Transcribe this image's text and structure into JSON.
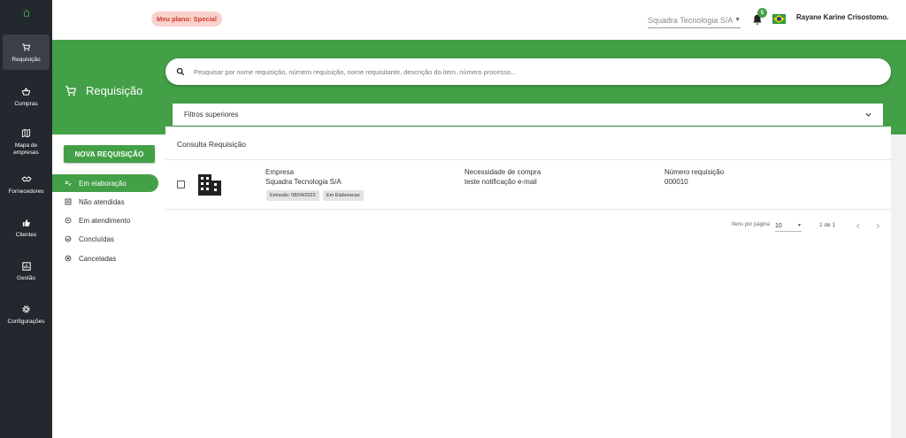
{
  "nav": {
    "items": [
      {
        "label": "Requisição"
      },
      {
        "label": "Compras"
      },
      {
        "label": "Mapa de empresas"
      },
      {
        "label": "Fornecedores"
      },
      {
        "label": "Clientes"
      },
      {
        "label": "Gestão"
      },
      {
        "label": "Configurações"
      }
    ]
  },
  "header": {
    "plan_badge": "Meu plano: Special",
    "company": "Squadra Tecnologia S/A",
    "notifications_count": "5",
    "user_name": "Rayane Karine Crisostomo"
  },
  "page": {
    "title": "Requisição"
  },
  "search": {
    "placeholder": "Pesquisar por nome requisição, número requisição, nome requisitante, descrição do item, número processo..."
  },
  "actions": {
    "new_requisition": "NOVA REQUISIÇÃO"
  },
  "status_menu": {
    "items": [
      {
        "label": "Em elaboração"
      },
      {
        "label": "Não atendidas"
      },
      {
        "label": "Em atendimento"
      },
      {
        "label": "Concluídas"
      },
      {
        "label": "Canceladas"
      }
    ]
  },
  "filters": {
    "label": "Filtros superiores"
  },
  "results": {
    "title": "Consulta Requisição",
    "rows": [
      {
        "company_label": "Empresa",
        "company": "Squadra Tecnologia S/A",
        "need_label": "Necessidade de compra",
        "need": "teste notificação e-mail",
        "number_label": "Número requisição",
        "number": "000010",
        "emission": "Emissão: 08/04/2022",
        "status": "Em Elaboracao"
      }
    ]
  },
  "pagination": {
    "items_per_page_label": "Itens por página",
    "items_per_page": "10",
    "range": "1 de 1"
  },
  "colors": {
    "primary": "#43a047",
    "sidebar": "#23272e",
    "badge_bg": "#f9d2cd",
    "badge_text": "#c93b2c"
  }
}
